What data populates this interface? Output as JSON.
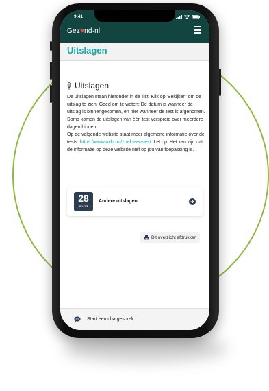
{
  "status_bar": {
    "time": "9:41"
  },
  "header": {
    "logo_left": "Gez",
    "logo_right": "nd·nl"
  },
  "page": {
    "title": "Uitslagen"
  },
  "section": {
    "title": "Uitslagen",
    "para1": "De uitslagen staan hieronder in de lijst. Klik op 'Bekijken' om de uitslag te zien. Goed om te weten: De datum is wanneer de uitslag is binnengekomen, en niet wanneer de test is afgenomen. Soms komen de uitslagen van één test verspreid over meerdere dagen binnen.",
    "para2_pre": "Op de volgende website staat meer algemene informatie over de tests: ",
    "para2_link": "https://www.nvkc.nl/zoek-een-test",
    "para2_post": ". Let op: Het kan zijn dat de informatie op deze website niet op jou van toepassing is."
  },
  "result_card": {
    "day": "28",
    "month": "jan. '22",
    "label": "Andere uitslagen"
  },
  "print_button": {
    "label": "Dit overzicht afdrukken"
  },
  "chat": {
    "label": "Start een chatgesprek"
  },
  "colors": {
    "header": "#12453f",
    "accent": "#1aa7a7",
    "ring": "#8dbb3c",
    "date_box": "#2e3c50",
    "heart": "#e8454f"
  },
  "icons": [
    "signal-icon",
    "wifi-icon",
    "battery-icon",
    "hamburger-menu-icon",
    "feather-icon",
    "arrow-right-icon",
    "printer-icon",
    "chat-bubble-icon"
  ]
}
